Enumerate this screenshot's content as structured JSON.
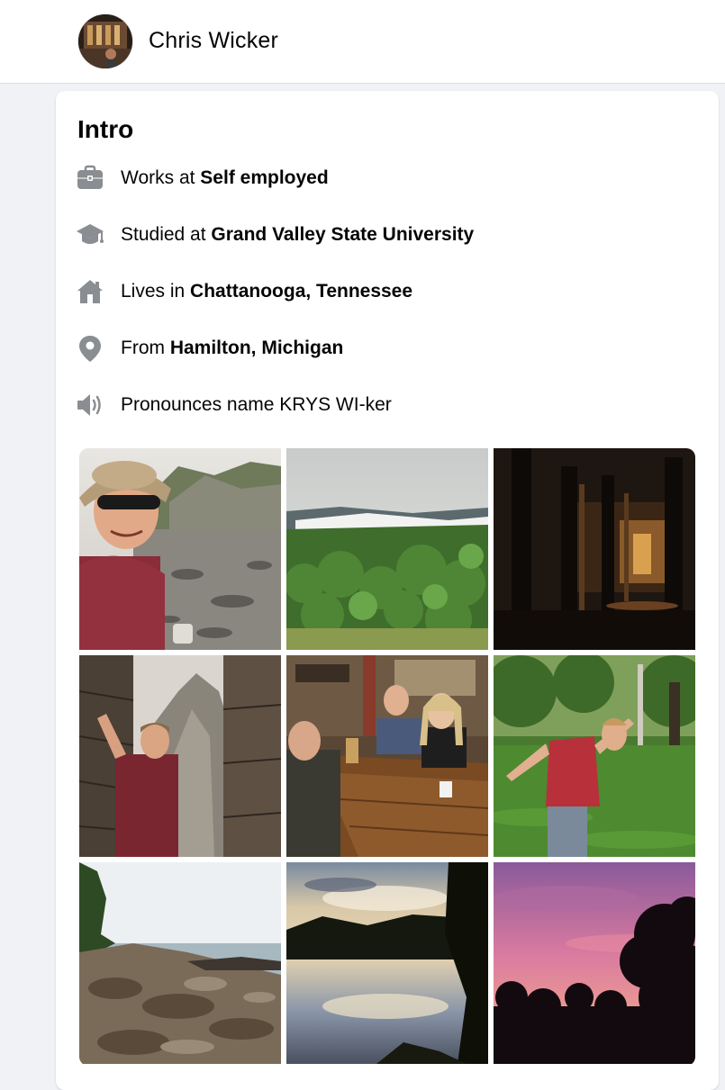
{
  "profile": {
    "name": "Chris Wicker"
  },
  "intro": {
    "title": "Intro",
    "items": [
      {
        "icon": "briefcase-icon",
        "prefix": "Works at ",
        "value": "Self employed"
      },
      {
        "icon": "graduation-cap-icon",
        "prefix": "Studied at ",
        "value": "Grand Valley State University"
      },
      {
        "icon": "home-icon",
        "prefix": "Lives in ",
        "value": "Chattanooga, Tennessee"
      },
      {
        "icon": "location-pin-icon",
        "prefix": "From ",
        "value": "Hamilton, Michigan"
      },
      {
        "icon": "speaker-icon",
        "prefix": "",
        "value": "Pronounces name KRYS WI-ker"
      }
    ]
  },
  "photos": [
    {
      "subject": "man in hat and sunglasses on rocky shore"
    },
    {
      "subject": "green forest valley with fog"
    },
    {
      "subject": "dark underground cistern with columns"
    },
    {
      "subject": "man standing among stone temple ruins"
    },
    {
      "subject": "three people at a restaurant table"
    },
    {
      "subject": "man posing on grass in a park"
    },
    {
      "subject": "rocky lake shoreline"
    },
    {
      "subject": "lake reflecting sky at dusk"
    },
    {
      "subject": "pink sunset sky over tree silhouettes"
    }
  ],
  "colors": {
    "icon": "#8a8d91",
    "page_background": "#f0f2f5",
    "card_background": "#ffffff",
    "text": "#050505"
  }
}
